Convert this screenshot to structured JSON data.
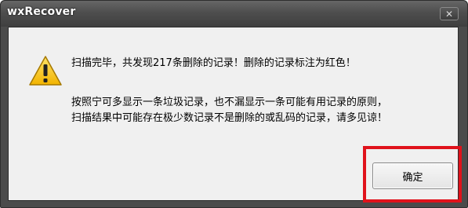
{
  "window": {
    "title": "wxRecover",
    "close_label": "✕"
  },
  "dialog": {
    "icon": "warning-icon",
    "message_line1": "扫描完毕，共发现217条删除的记录！删除的记录标注为红色！",
    "message_line2": "按照宁可多显示一条垃圾记录，也不漏显示一条可能有用记录的原则，",
    "message_line3": "扫描结果中可能存在极少数记录不是删除的或乱码的记录，请多见谅！",
    "ok_label": "确定"
  },
  "colors": {
    "highlight": "#e0121b",
    "titlebar": "#4b4b4b",
    "warning_fill": "#f5c000"
  }
}
